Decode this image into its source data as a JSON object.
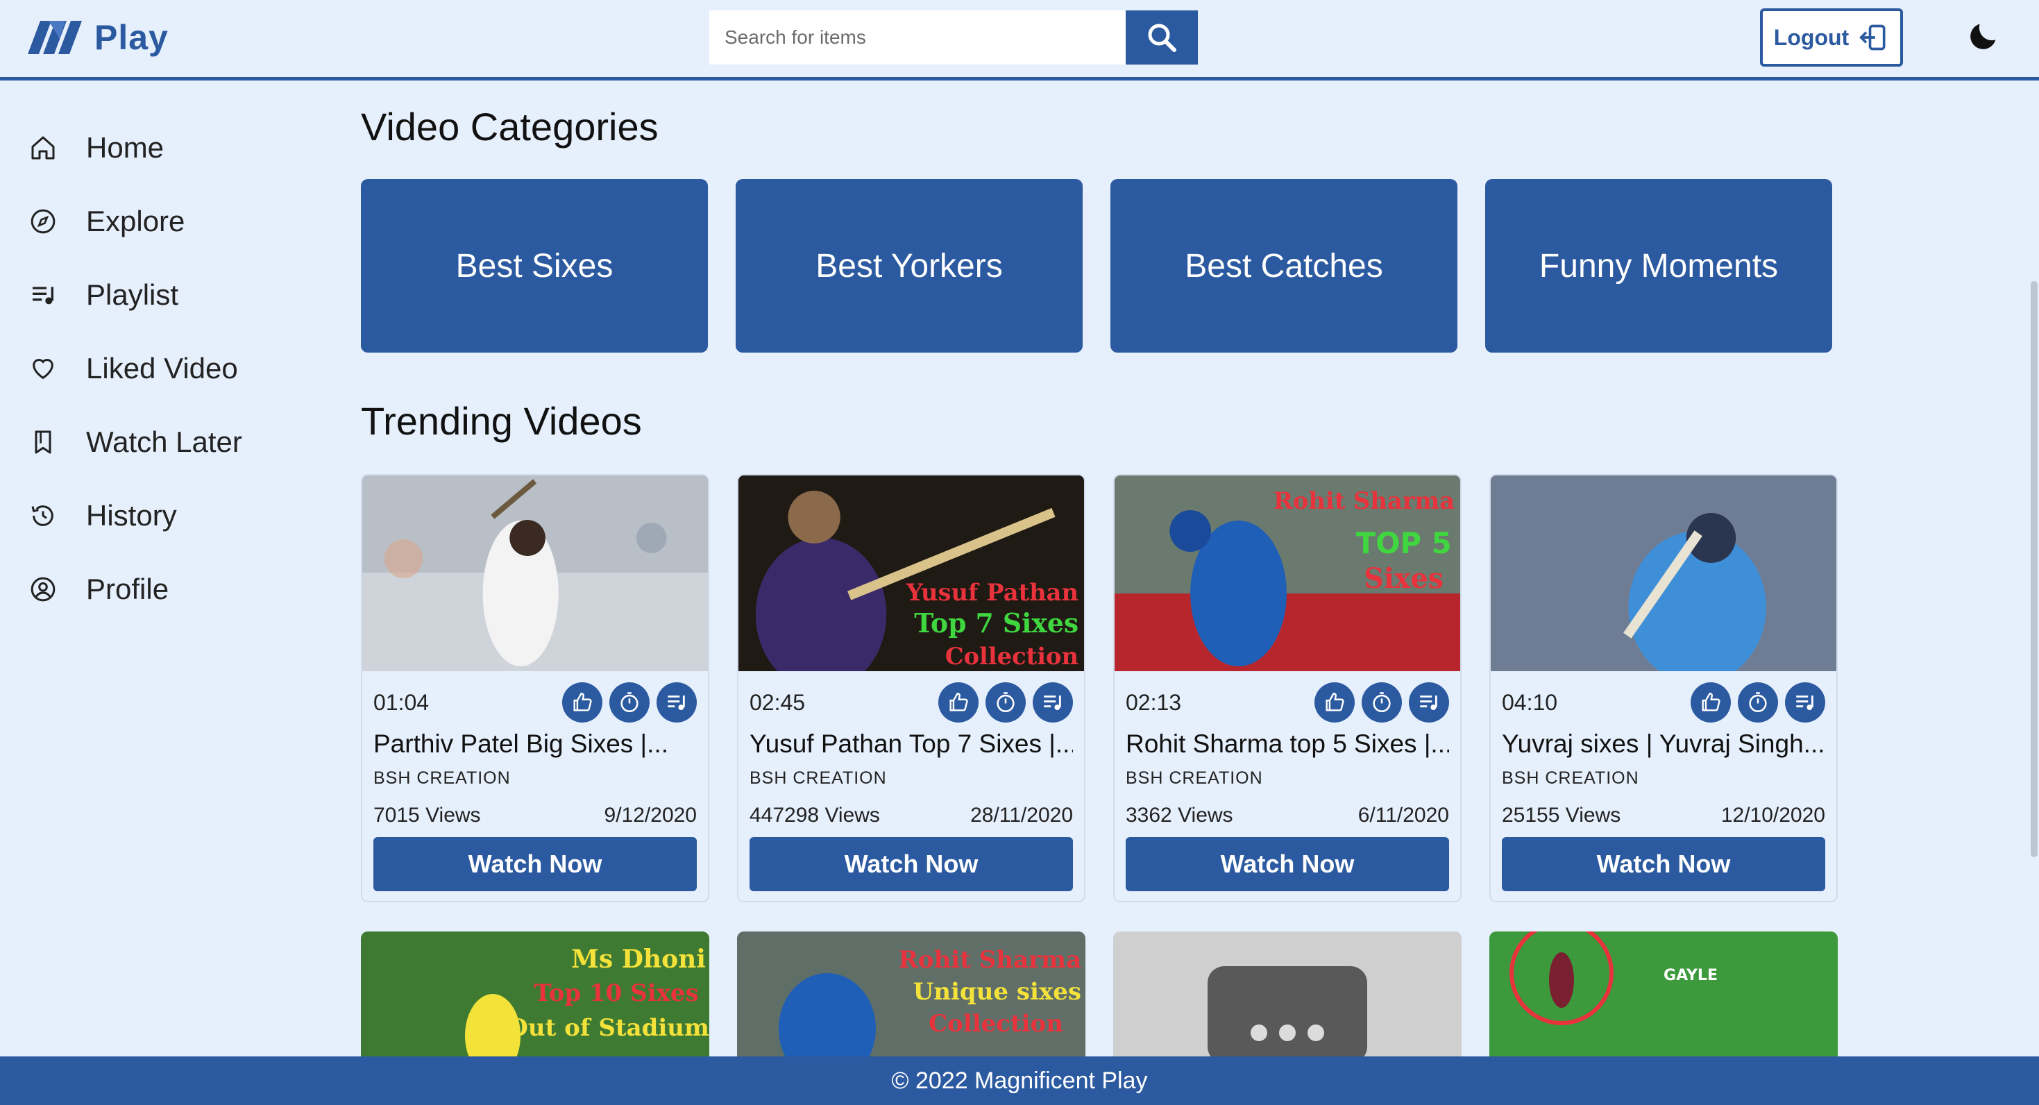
{
  "brand": {
    "name": "Play"
  },
  "search": {
    "placeholder": "Search for items"
  },
  "header": {
    "logout_label": "Logout"
  },
  "sidebar": {
    "items": [
      {
        "label": "Home",
        "icon": "home-icon"
      },
      {
        "label": "Explore",
        "icon": "compass-icon"
      },
      {
        "label": "Playlist",
        "icon": "playlist-icon"
      },
      {
        "label": "Liked Video",
        "icon": "heart-icon"
      },
      {
        "label": "Watch Later",
        "icon": "bookmark-icon"
      },
      {
        "label": "History",
        "icon": "history-icon"
      },
      {
        "label": "Profile",
        "icon": "user-circle-icon"
      }
    ]
  },
  "main": {
    "categories_title": "Video Categories",
    "categories": [
      "Best Sixes",
      "Best Yorkers",
      "Best Catches",
      "Funny Moments"
    ],
    "trending_title": "Trending Videos",
    "videos": [
      {
        "duration": "01:04",
        "title": "Parthiv Patel Big Sixes |...",
        "channel": "BSH CREATION",
        "views": "7015 Views",
        "date": "9/12/2020",
        "watch_label": "Watch Now"
      },
      {
        "duration": "02:45",
        "title": "Yusuf Pathan Top 7 Sixes |...",
        "channel": "BSH CREATION",
        "views": "447298 Views",
        "date": "28/11/2020",
        "watch_label": "Watch Now",
        "thumb_text": [
          "Yusuf Pathan",
          "Top 7 Sixes",
          "Collection"
        ]
      },
      {
        "duration": "02:13",
        "title": "Rohit Sharma top 5 Sixes |...",
        "channel": "BSH CREATION",
        "views": "3362 Views",
        "date": "6/11/2020",
        "watch_label": "Watch Now",
        "thumb_text": [
          "Rohit Sharma",
          "TOP 5",
          "Sixes"
        ]
      },
      {
        "duration": "04:10",
        "title": "Yuvraj sixes | Yuvraj Singh...",
        "channel": "BSH CREATION",
        "views": "25155 Views",
        "date": "12/10/2020",
        "watch_label": "Watch Now"
      }
    ],
    "more_thumbs": [
      {
        "thumb_text": [
          "Ms Dhoni",
          "Top 10 Sixes",
          "Out of Stadium"
        ]
      },
      {
        "thumb_text": [
          "Rohit Sharma",
          "Unique sixes",
          "Collection"
        ]
      },
      {
        "thumb_text": []
      },
      {
        "thumb_text": [
          "GAYLE"
        ]
      }
    ]
  },
  "footer": {
    "text": "© 2022 Magnificent Play"
  },
  "colors": {
    "primary": "#2c5aa0",
    "background": "#e6effc"
  }
}
